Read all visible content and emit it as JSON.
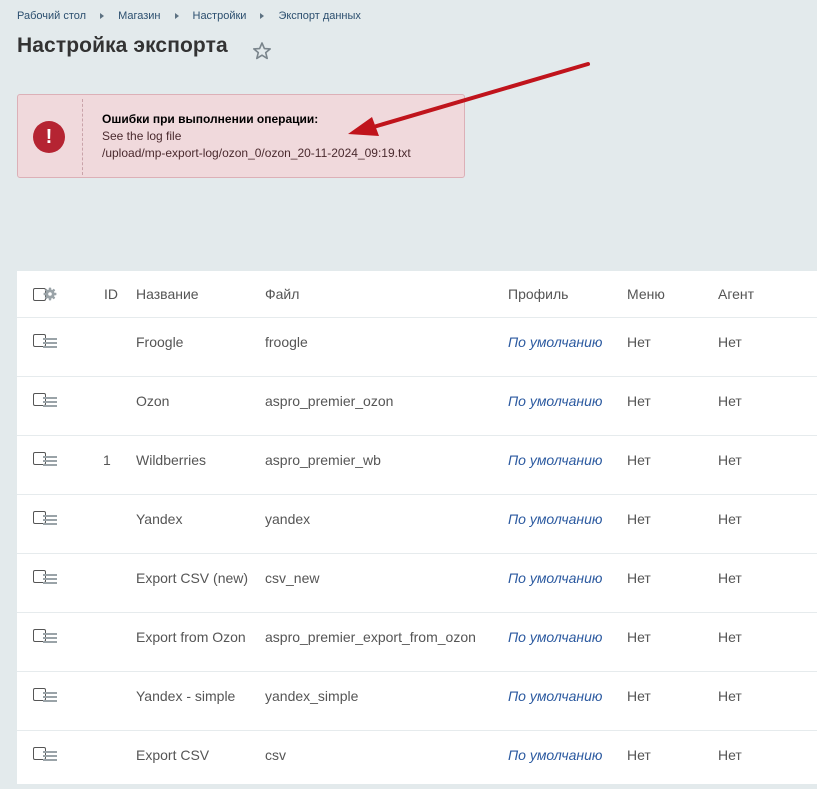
{
  "breadcrumb": [
    "Рабочий стол",
    "Магазин",
    "Настройки",
    "Экспорт данных"
  ],
  "page": {
    "title": "Настройка экспорта"
  },
  "alert": {
    "icon": "!",
    "title": "Ошибки при выполнении операции:",
    "line1": "See the log file",
    "line2": "/upload/mp-export-log/ozon_0/ozon_20-11-2024_09:19.txt"
  },
  "table": {
    "headers": {
      "id": "ID",
      "name": "Название",
      "file": "Файл",
      "profile": "Профиль",
      "menu": "Меню",
      "agent": "Агент"
    },
    "rows": [
      {
        "id": "",
        "name": "Froogle",
        "file": "froogle",
        "profile": "По умолчанию",
        "menu": "Нет",
        "agent": "Нет"
      },
      {
        "id": "",
        "name": "Ozon",
        "file": "aspro_premier_ozon",
        "profile": "По умолчанию",
        "menu": "Нет",
        "agent": "Нет"
      },
      {
        "id": "1",
        "name": "Wildberries",
        "file": "aspro_premier_wb",
        "profile": "По умолчанию",
        "menu": "Нет",
        "agent": "Нет"
      },
      {
        "id": "",
        "name": "Yandex",
        "file": "yandex",
        "profile": "По умолчанию",
        "menu": "Нет",
        "agent": "Нет"
      },
      {
        "id": "",
        "name": "Export CSV (new)",
        "file": "csv_new",
        "profile": "По умолчанию",
        "menu": "Нет",
        "agent": "Нет"
      },
      {
        "id": "",
        "name": "Export from Ozon",
        "file": "aspro_premier_export_from_ozon",
        "profile": "По умолчанию",
        "menu": "Нет",
        "agent": "Нет"
      },
      {
        "id": "",
        "name": "Yandex - simple",
        "file": "yandex_simple",
        "profile": "По умолчанию",
        "menu": "Нет",
        "agent": "Нет"
      },
      {
        "id": "",
        "name": "Export CSV",
        "file": "csv",
        "profile": "По умолчанию",
        "menu": "Нет",
        "agent": "Нет"
      }
    ]
  },
  "icons": {
    "star": "star-icon",
    "gear": "gear-icon",
    "drag": "drag-handle-icon",
    "error": "error-icon",
    "arrow": "annotation-arrow"
  },
  "colors": {
    "alert_bg": "#f0d9dc",
    "error_icon": "#b52432",
    "arrow": "#c0141c",
    "link": "#2c5aa0"
  }
}
